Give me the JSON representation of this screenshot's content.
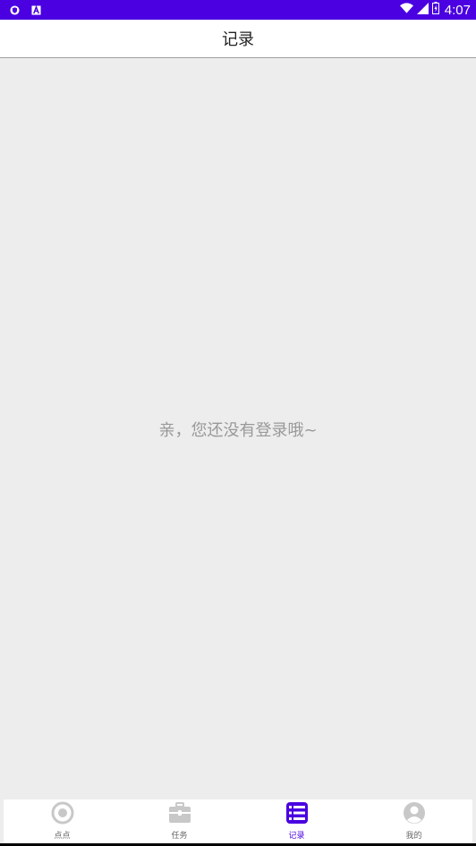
{
  "status_bar": {
    "time": "4:07",
    "left_icons": [
      "shield-icon",
      "a-badge-icon"
    ],
    "right_icons": [
      "wifi-icon",
      "signal-icon",
      "battery-icon"
    ],
    "background": "#4a00e0"
  },
  "header": {
    "title": "记录"
  },
  "main": {
    "empty_message": "亲，您还没有登录哦~"
  },
  "tabbar": {
    "accent": "#4a00e0",
    "items": [
      {
        "label": "点点",
        "icon": "target-icon",
        "active": false
      },
      {
        "label": "任务",
        "icon": "briefcase-icon",
        "active": false
      },
      {
        "label": "记录",
        "icon": "list-icon",
        "active": true
      },
      {
        "label": "我的",
        "icon": "user-icon",
        "active": false
      }
    ]
  }
}
